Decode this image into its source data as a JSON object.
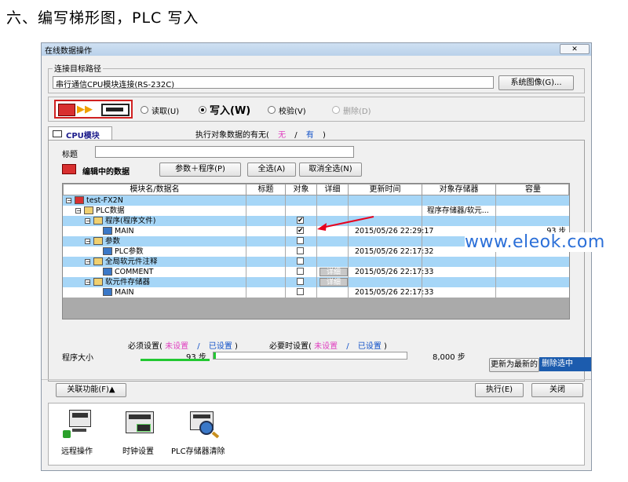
{
  "heading": "六、编写梯形图，PLC 写入",
  "watermark": "www.eleok.com",
  "dialog": {
    "title": "在线数据操作",
    "close_glyph": "✕"
  },
  "connection": {
    "group_label": "连接目标路径",
    "path": "串行通信CPU模块连接(RS-232C)",
    "system_image_button": "系统图像(G)..."
  },
  "operations": {
    "read": "读取(U)",
    "write": "写入(W)",
    "verify": "校验(V)",
    "delete": "删除(D)",
    "selected": "write"
  },
  "tab": {
    "label": "CPU模块",
    "target_info_prefix": "执行对象数据的有无(",
    "none": "无",
    "slash": "/",
    "has": "有",
    "target_info_suffix": ")"
  },
  "title_field": {
    "label": "标题",
    "value": ""
  },
  "editing": {
    "label": "编辑中的数据",
    "buttons": [
      "参数＋程序(P)",
      "全选(A)",
      "取消全选(N)"
    ]
  },
  "grid": {
    "columns": [
      "模块名/数据名",
      "标题",
      "对象",
      "详细",
      "更新时间",
      "对象存储器",
      "容量"
    ],
    "rows": [
      {
        "indent": 0,
        "name": "test-FX2N",
        "checked": null,
        "detail": false,
        "time": "",
        "memory": "",
        "size": "",
        "color": "#a6d6f7"
      },
      {
        "indent": 1,
        "name": "PLC数据",
        "checked": null,
        "detail": false,
        "time": "",
        "memory": "程序存储器/软元...",
        "size": "",
        "color": "#ffffff"
      },
      {
        "indent": 2,
        "name": "程序(程序文件)",
        "checked": true,
        "detail": false,
        "time": "",
        "memory": "",
        "size": "",
        "color": "#a6d6f7"
      },
      {
        "indent": 3,
        "name": "MAIN",
        "checked": true,
        "detail": false,
        "time": "2015/05/26 22:29:17",
        "memory": "",
        "size": "93 步",
        "color": "#ffffff"
      },
      {
        "indent": 2,
        "name": "参数",
        "checked": false,
        "detail": false,
        "time": "",
        "memory": "",
        "size": "",
        "color": "#a6d6f7"
      },
      {
        "indent": 3,
        "name": "PLC参数",
        "checked": false,
        "detail": false,
        "time": "2015/05/26 22:17:32",
        "memory": "",
        "size": "",
        "color": "#ffffff"
      },
      {
        "indent": 2,
        "name": "全局软元件注释",
        "checked": false,
        "detail": false,
        "time": "",
        "memory": "",
        "size": "",
        "color": "#a6d6f7"
      },
      {
        "indent": 3,
        "name": "COMMENT",
        "checked": false,
        "detail": true,
        "time": "2015/05/26 22:17:33",
        "memory": "",
        "size": "",
        "color": "#ffffff"
      },
      {
        "indent": 2,
        "name": "软元件存储器",
        "checked": false,
        "detail": true,
        "time": "",
        "memory": "",
        "size": "",
        "color": "#a6d6f7"
      },
      {
        "indent": 3,
        "name": "MAIN",
        "checked": false,
        "detail": false,
        "time": "2015/05/26 22:17:33",
        "memory": "",
        "size": "",
        "color": "#ffffff"
      }
    ],
    "detail_label": "详细"
  },
  "settings": {
    "required_prefix": "必须设置(",
    "required_unset": "未设置",
    "slash": "/",
    "required_set": "已设置",
    "required_suffix": ")",
    "optional_prefix": "必要时设置(",
    "optional_unset": "未设置",
    "optional_set": "已设置",
    "optional_suffix": ")"
  },
  "program_size": {
    "label": "程序大小",
    "used": "93 步",
    "total": "8,000 步",
    "fraction": 0.0116
  },
  "footer": {
    "update_button": "更新为最新的",
    "delete_selected": "删除选中",
    "related": "关联功能(F)▲",
    "execute": "执行(E)",
    "close": "关闭"
  },
  "quick_icons": [
    {
      "label": "远程操作",
      "icon": "remote-operation-icon"
    },
    {
      "label": "时钟设置",
      "icon": "clock-setting-icon"
    },
    {
      "label": "PLC存储器清除",
      "icon": "memory-clear-icon"
    }
  ],
  "colors": {
    "row_highlight": "#a6d6f7",
    "accent_red": "#e8001c",
    "accent_blue": "#1050c8",
    "unset_pink": "#e040c0",
    "progress_green": "#22c832"
  }
}
